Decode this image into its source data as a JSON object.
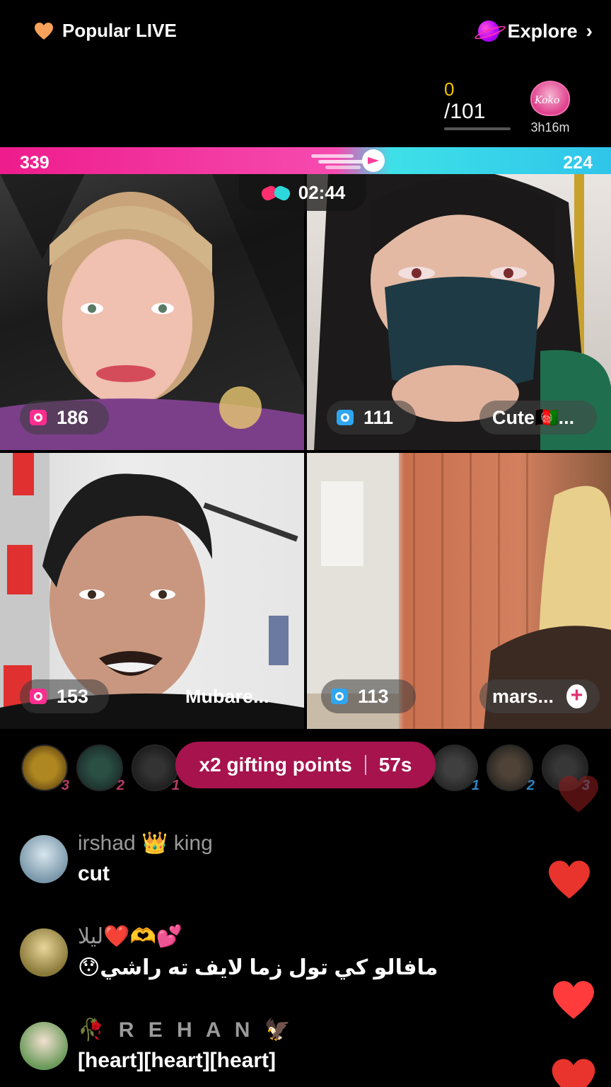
{
  "header": {
    "popular_label": "Popular LIVE",
    "explore_label": "Explore"
  },
  "goal": {
    "current": "0",
    "total": "/101",
    "progress": 0
  },
  "host": {
    "avatar_text": "Koko",
    "timer": "3h16m"
  },
  "battle": {
    "left_score": "339",
    "right_score": "224",
    "countdown": "02:44",
    "colors": {
      "left": "#ee1c8c",
      "right": "#2fc5ea"
    }
  },
  "tiles": [
    {
      "viewers": "186",
      "name": ""
    },
    {
      "viewers": "111",
      "name": "Cute🇦🇫..."
    },
    {
      "viewers": "153",
      "name": "Mubare..."
    },
    {
      "viewers": "113",
      "name": "mars..."
    }
  ],
  "gifters": {
    "left_ranks": [
      "3",
      "2",
      "1"
    ],
    "right_ranks": [
      "1",
      "2",
      "3"
    ]
  },
  "gifting_banner": {
    "label": "x2 gifting points",
    "time": "57s"
  },
  "chat": [
    {
      "user_a": "irshad",
      "user_b": "king",
      "message": "cut"
    },
    {
      "user": "ليلا❤️🫶💕",
      "message": "😯مافالو کي تول زما لايف ته راشي"
    },
    {
      "user": "🥀 R E H A N 🦅",
      "message": "[heart][heart][heart]"
    }
  ],
  "icons": [
    "heart-icon",
    "planet-icon",
    "chevron-right-icon",
    "boxing-gloves-icon",
    "camera-icon",
    "plus-icon",
    "crown-icon"
  ]
}
